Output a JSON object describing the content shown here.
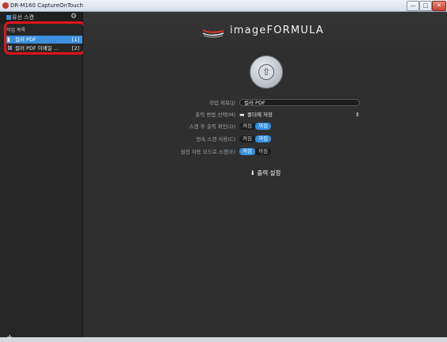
{
  "window": {
    "title": "DR-M160 CaptureOnTouch",
    "controls": {
      "minimize": "—",
      "maximize": "□",
      "close": "✕"
    }
  },
  "sidebar": {
    "header_label": "유선 스캔",
    "settings_icon": "gear-icon",
    "category_label": "작업 목록",
    "jobs": [
      {
        "icon": "pdf-document-icon",
        "label": "컬러 PDF",
        "count": "[1]",
        "selected": true
      },
      {
        "icon": "paperclip-icon",
        "label": "컬러 PDF 이메일 ...",
        "count": "[2]",
        "selected": false
      }
    ],
    "add_label": "+"
  },
  "main": {
    "brand": {
      "name": "imageFORMULA",
      "logo_icon": "wave-logo-icon"
    },
    "start_icon": "scan-start-arrow-icon",
    "fields": {
      "job_title": {
        "label": "작업 제목(J)",
        "value": "컬러 PDF"
      },
      "output_method": {
        "label": "출력 방법 선택(M)",
        "value": "폴더에 저장"
      },
      "check_after_scan": {
        "label": "스캔 후 출력 확인(O)",
        "on": "켜짐",
        "off": "꺼짐",
        "selected": "off"
      },
      "continuous_scan": {
        "label": "연속 스캔 사용(C)",
        "on": "켜짐",
        "off": "꺼짐",
        "selected": "off"
      },
      "auto_start": {
        "label": "원전 자동 모드로 스캔(E)",
        "on": "켜짐",
        "off": "꺼짐",
        "selected": "on"
      }
    },
    "output_settings_label": "출력 설정",
    "output_settings_icon": "arrow-down-icon"
  },
  "colors": {
    "accent": "#2f8ee0",
    "selection": "#3b8fdc",
    "highlight": "#e0141b",
    "background": "#2f2f2f"
  }
}
